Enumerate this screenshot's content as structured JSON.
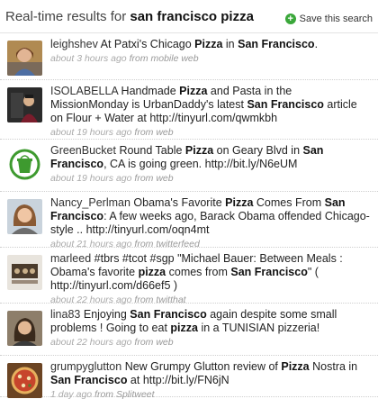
{
  "header": {
    "title_prefix": "Real-time results for",
    "query": "san francisco pizza",
    "save_label": "Save this search"
  },
  "tweets": [
    {
      "user": "leighshev",
      "parts": [
        [
          "At Patxi's Chicago ",
          0
        ],
        [
          "Pizza",
          1
        ],
        [
          " in ",
          0
        ],
        [
          "San Francisco",
          1
        ],
        [
          ".",
          0
        ]
      ],
      "time": "about 3 hours ago",
      "source": "from mobile web"
    },
    {
      "user": "ISOLABELLA",
      "parts": [
        [
          "Handmade ",
          0
        ],
        [
          "Pizza",
          1
        ],
        [
          " and Pasta in the MissionMonday is UrbanDaddy's latest ",
          0
        ],
        [
          "San Francisco",
          1
        ],
        [
          " article on Flour + Water at http://tinyurl.com/qwmkbh",
          0
        ]
      ],
      "time": "about 19 hours ago",
      "source": "from web"
    },
    {
      "user": "GreenBucket",
      "parts": [
        [
          "Round Table ",
          0
        ],
        [
          "Pizza",
          1
        ],
        [
          " on Geary Blvd in ",
          0
        ],
        [
          "San Francisco",
          1
        ],
        [
          ", CA is going green. http://bit.ly/N6eUM",
          0
        ]
      ],
      "time": "about 19 hours ago",
      "source": "from web"
    },
    {
      "user": "Nancy_Perlman",
      "parts": [
        [
          "Obama's Favorite ",
          0
        ],
        [
          "Pizza",
          1
        ],
        [
          " Comes From ",
          0
        ],
        [
          "San Francisco",
          1
        ],
        [
          ": A few weeks ago, Barack Obama offended Chicago-style .. http://tinyurl.com/oqn4mt",
          0
        ]
      ],
      "time": "about 21 hours ago",
      "source": "from twitterfeed"
    },
    {
      "user": "marleed",
      "parts": [
        [
          "#tbrs #tcot #sgp \"Michael Bauer: Between Meals : Obama's favorite ",
          0
        ],
        [
          "pizza",
          1
        ],
        [
          " comes from ",
          0
        ],
        [
          "San Francisco",
          1
        ],
        [
          "\" ( http://tinyurl.com/d66ef5 )",
          0
        ]
      ],
      "time": "about 22 hours ago",
      "source": "from twitthat"
    },
    {
      "user": "lina83",
      "parts": [
        [
          "Enjoying ",
          0
        ],
        [
          "San Francisco",
          1
        ],
        [
          " again despite some small problems ! Going to eat ",
          0
        ],
        [
          "pizza",
          1
        ],
        [
          " in a TUNISIAN pizzeria!",
          0
        ]
      ],
      "time": "about 22 hours ago",
      "source": "from web"
    },
    {
      "user": "grumpyglutton",
      "parts": [
        [
          "New Grumpy Glutton review of ",
          0
        ],
        [
          "Pizza",
          1
        ],
        [
          " Nostra in ",
          0
        ],
        [
          "San Francisco",
          1
        ],
        [
          " at http://bit.ly/FN6jN",
          0
        ]
      ],
      "time": "1 day ago",
      "source": "from Splitweet"
    }
  ]
}
